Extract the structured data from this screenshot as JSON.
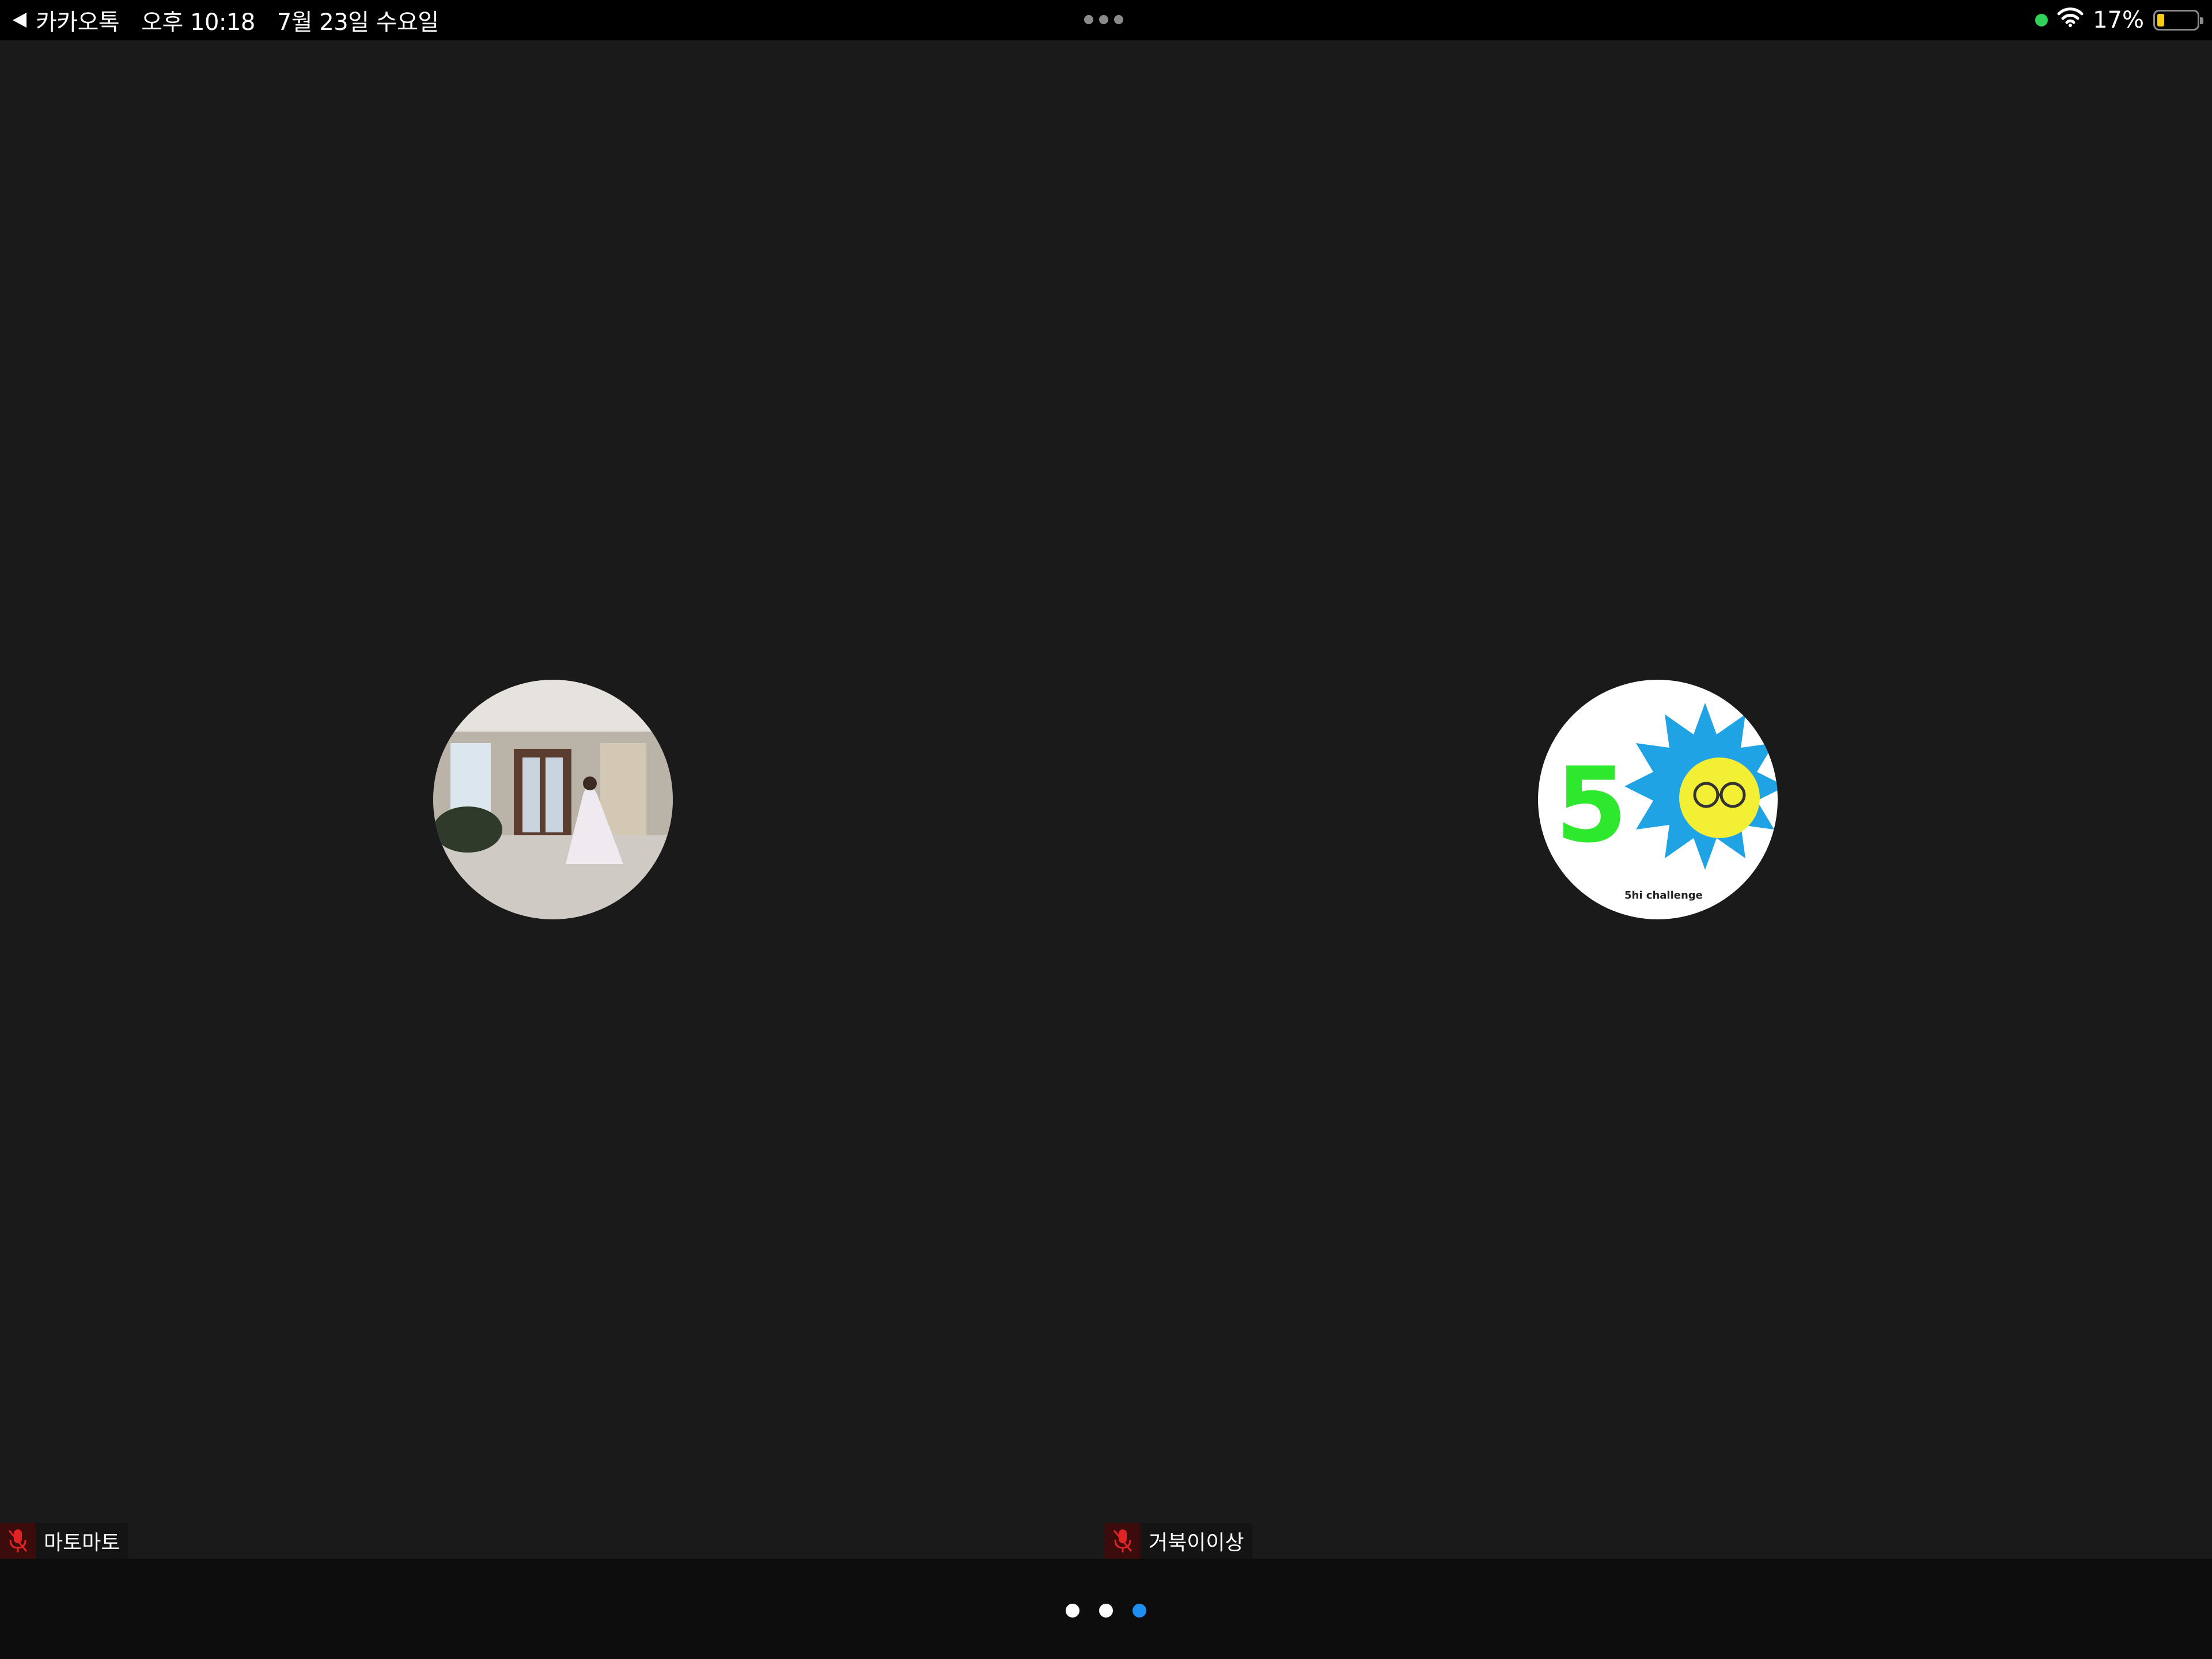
{
  "status_bar": {
    "back_app": "카카오톡",
    "time": "오후 10:18",
    "date": "7월 23일 수요일",
    "battery": "17%",
    "battery_level": 0.17,
    "camera_indicator_color": "#2fd158"
  },
  "participants": [
    {
      "name": "마토마토",
      "mic": "muted",
      "avatar": "photo-bride-in-room"
    },
    {
      "name": "거북이이상",
      "mic": "muted",
      "avatar": "logo-5-sun-challenge",
      "avatar_text": "5",
      "avatar_caption": "5hi challenge"
    }
  ],
  "pager": {
    "pages": 3,
    "current": 3,
    "active_color": "#1f8ef1"
  },
  "colors": {
    "background": "#1a1a1a",
    "status_bar": "#000000",
    "mic_muted": "#e02424"
  }
}
